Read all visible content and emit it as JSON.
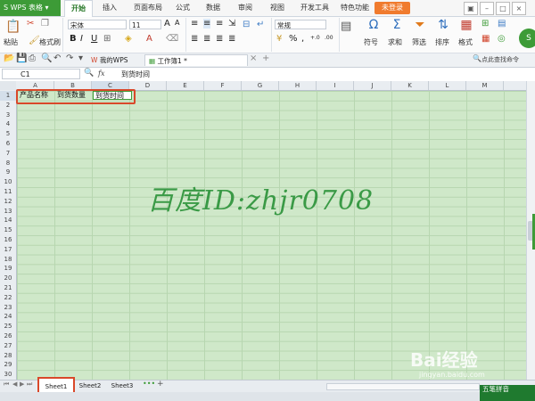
{
  "app": {
    "name": "WPS 表格",
    "login_label": "未登录"
  },
  "menu": [
    "开始",
    "插入",
    "页面布局",
    "公式",
    "数据",
    "审阅",
    "视图",
    "开发工具",
    "特色功能"
  ],
  "ribbon": {
    "paste": "粘贴",
    "format_painter": "格式刷",
    "font_name": "宋体",
    "font_size": "11",
    "number_format": "常规",
    "symbol": "符号",
    "sum": "求和",
    "filter": "筛选",
    "sort": "排序",
    "format": "格式",
    "find_placeholder": "点此查找命令",
    "bold": "B",
    "italic": "I",
    "underline": "U",
    "percent": "%",
    "thousands": ",",
    "inc_dec": "+.0",
    "dec_dec": ".00"
  },
  "doc_tabs": [
    {
      "label": "我的WPS"
    },
    {
      "label": "工作簿1 *"
    }
  ],
  "formula_bar": {
    "cell_ref": "C1",
    "fx": "fx",
    "content": "到货时间"
  },
  "columns": [
    "A",
    "B",
    "C",
    "D",
    "E",
    "F",
    "G",
    "H",
    "I",
    "J",
    "K",
    "L",
    "M"
  ],
  "rows": [
    "1",
    "2",
    "3",
    "4",
    "5",
    "6",
    "7",
    "8",
    "9",
    "10",
    "11",
    "12",
    "13",
    "14",
    "15",
    "16",
    "17",
    "18",
    "19",
    "20",
    "21",
    "22",
    "23",
    "24",
    "25",
    "26",
    "27",
    "28",
    "29",
    "30"
  ],
  "cells": {
    "A1": "产品名称",
    "B1": "到货数量",
    "C1": "到货时间"
  },
  "sheets": [
    "Sheet1",
    "Sheet2",
    "Sheet3"
  ],
  "ime_label": "五笔拼音",
  "watermark": {
    "id": "百度ID:zhjr0708",
    "baidu": "Bai经验",
    "url": "jingyan.baidu.com"
  },
  "colors": {
    "accent_green": "#3d9b37",
    "sheet_bg": "#cfe8c9",
    "highlight_red": "#d9482a",
    "login_orange": "#f07b2e"
  }
}
